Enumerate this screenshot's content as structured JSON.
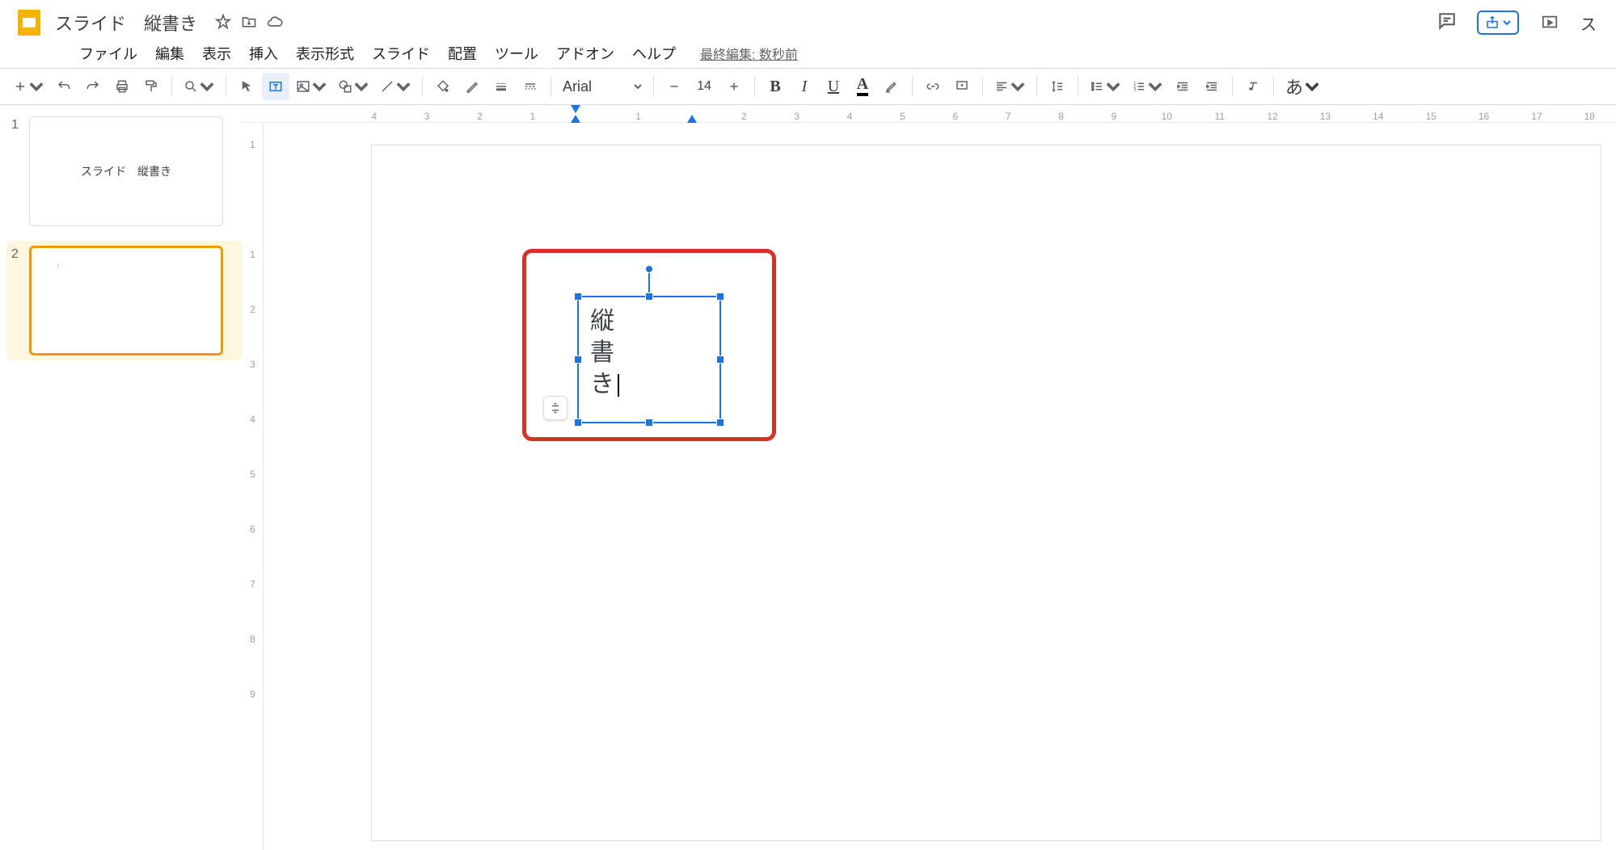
{
  "doc": {
    "title": "スライド　縦書き"
  },
  "header": {
    "last_edit": "最終編集: 数秒前"
  },
  "menu": {
    "file": "ファイル",
    "edit": "編集",
    "view": "表示",
    "insert": "挿入",
    "format": "表示形式",
    "slide": "スライド",
    "arrange": "配置",
    "tools": "ツール",
    "addons": "アドオン",
    "help": "ヘルプ"
  },
  "toolbar": {
    "font_name": "Arial",
    "font_size": "14",
    "ime_hint": "あ"
  },
  "top_right": {
    "present_letter": "ス"
  },
  "filmstrip": {
    "slides": [
      {
        "num": "1",
        "title": "スライド　縦書き",
        "active": false
      },
      {
        "num": "2",
        "title": "",
        "active": true
      }
    ]
  },
  "ruler_h": [
    "4",
    "3",
    "2",
    "1",
    "",
    "1",
    "",
    "2",
    "3",
    "4",
    "5",
    "6",
    "7",
    "8",
    "9",
    "10",
    "11",
    "12",
    "13",
    "14",
    "15",
    "16",
    "17",
    "18"
  ],
  "ruler_v": [
    "1",
    "",
    "1",
    "2",
    "3",
    "4",
    "5",
    "6",
    "7",
    "8",
    "9"
  ],
  "canvas": {
    "textbox": {
      "lines": [
        "縦",
        "書",
        "き"
      ]
    }
  }
}
